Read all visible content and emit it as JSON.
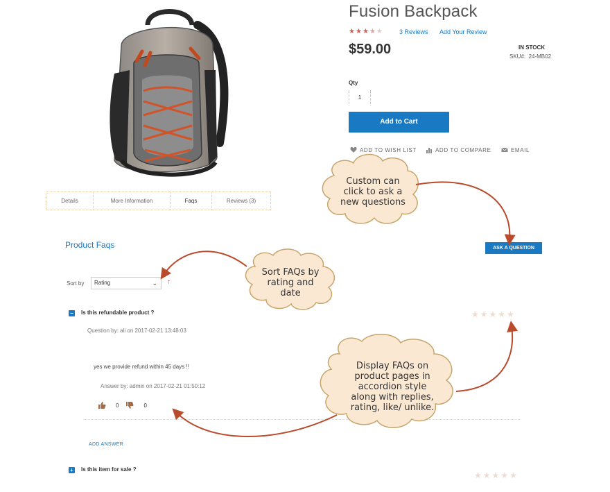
{
  "product": {
    "title": "Fusion Backpack",
    "rating_percent": 67,
    "reviews_link": "3 Reviews",
    "add_review_link": "Add Your Review",
    "price": "$59.00",
    "stock_status": "IN STOCK",
    "sku_label": "SKU#:",
    "sku_value": "24-MB02",
    "qty_label": "Qty",
    "qty_value": "1",
    "add_to_cart": "Add to Cart",
    "actions": {
      "wishlist": "ADD TO WISH LIST",
      "compare": "ADD TO COMPARE",
      "email": "EMAIL"
    }
  },
  "tabs": [
    {
      "label": "Details"
    },
    {
      "label": "More Information"
    },
    {
      "label": "Faqs"
    },
    {
      "label": "Reviews (3)"
    }
  ],
  "faq_section": {
    "heading": "Product Faqs",
    "ask_button": "ASK A QUESTION",
    "sort_label": "Sort by",
    "sort_value": "Rating",
    "sort_direction_icon": "arrow-up-icon",
    "items": [
      {
        "toggle": "−",
        "question": "Is this refundable product ?",
        "question_meta": "Question by: ali on 2017-02-21 13:48:03",
        "answer": "yes we provide refund within 45 days !!",
        "answer_meta": "Answer by: admin on 2017-02-21 01:50:12",
        "likes": "0",
        "dislikes": "0",
        "add_answer": "ADD ANSWER",
        "rating_stars": 0
      },
      {
        "toggle": "+",
        "question": "Is this item for sale ?",
        "rating_stars": 0
      }
    ]
  },
  "callouts": {
    "ask": [
      "Custom can",
      "click to ask a",
      "new questions"
    ],
    "sort": [
      "Sort FAQs by",
      "rating and",
      "date"
    ],
    "display": [
      "Display FAQs on",
      "product pages in",
      "accordion style",
      "along with replies,",
      "rating, like/ unlike."
    ]
  },
  "colors": {
    "accent": "#1979c3",
    "annotation": "#b94a2b",
    "cloud_fill": "#fbe8d3",
    "cloud_stroke": "#c8a56a"
  }
}
